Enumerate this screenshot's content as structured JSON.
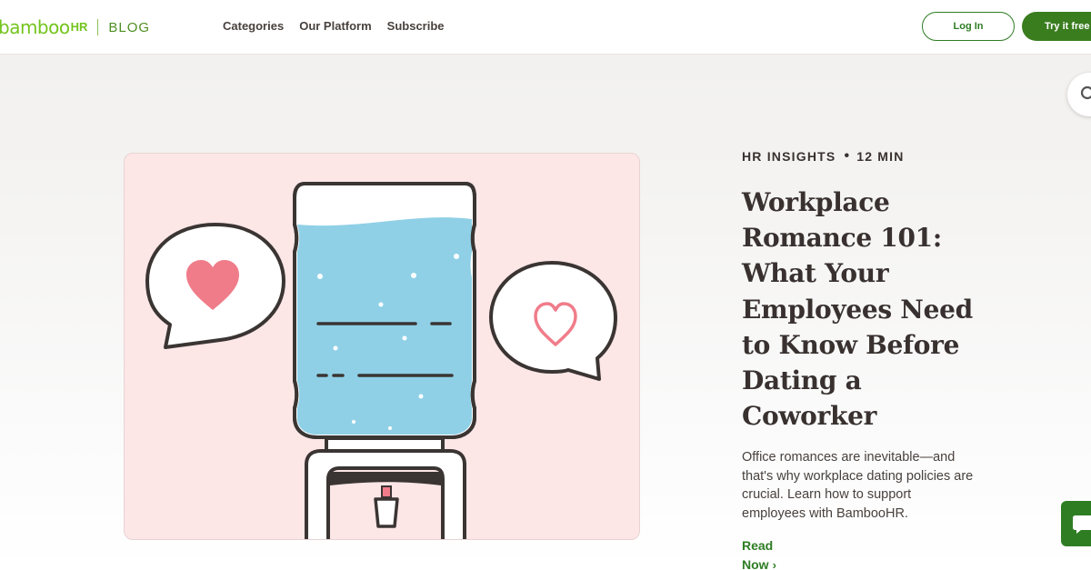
{
  "header": {
    "logo_word": "bamboo",
    "logo_hr": "HR",
    "logo_blog": "BLOG",
    "nav": [
      "Categories",
      "Our Platform",
      "Subscribe"
    ],
    "login_label": "Log In",
    "try_label": "Try it free"
  },
  "article": {
    "category": "HR INSIGHTS",
    "separator": "•",
    "read_time": "12 MIN",
    "title": "Workplace Romance 101: What Your Employees Need to Know Before Dating a Coworker",
    "description": "Office romances are inevitable—and that's why workplace dating policies are crucial. Learn how to support employees with BambooHR.",
    "read_label": "Read Now",
    "chevron": "›"
  },
  "colors": {
    "brand_green": "#73c41d",
    "dark_green": "#2e7d23",
    "card_pink": "#fde6e6",
    "water_blue": "#8fd0e6",
    "heart_pink": "#f07c8a"
  },
  "icons": {
    "search": "search-icon",
    "chat": "chat-icon",
    "heart": "heart-icon"
  }
}
